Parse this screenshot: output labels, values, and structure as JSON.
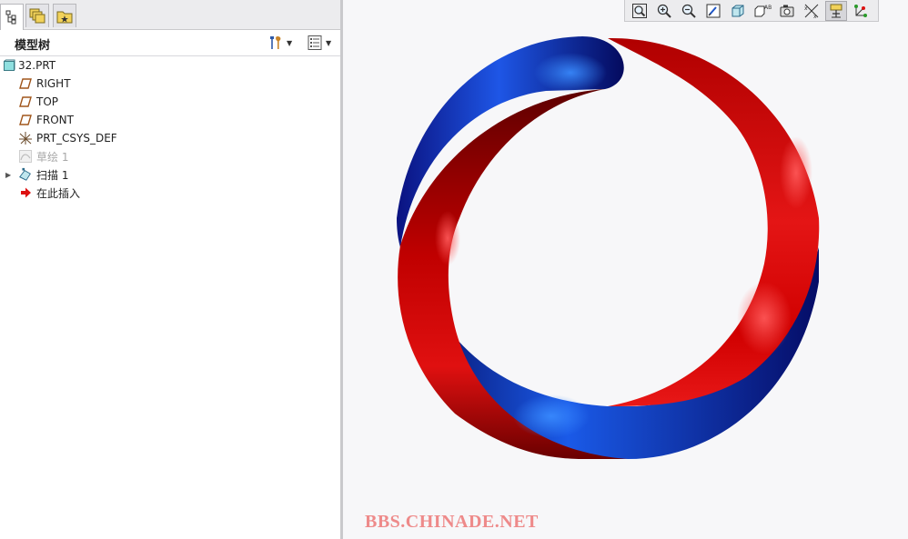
{
  "tabs": [
    {
      "icon": "model-tree-icon"
    },
    {
      "icon": "layers-icon"
    },
    {
      "icon": "folder-favorites-icon"
    }
  ],
  "tree_header": {
    "title": "模型树",
    "settings_icon": "tools-icon",
    "show_icon": "list-settings-icon"
  },
  "tree": {
    "items": [
      {
        "label": "32.PRT",
        "icon": "part-icon",
        "muted": false,
        "expander": false
      },
      {
        "label": "RIGHT",
        "icon": "datum-plane-icon",
        "muted": false,
        "expander": false
      },
      {
        "label": "TOP",
        "icon": "datum-plane-icon",
        "muted": false,
        "expander": false
      },
      {
        "label": "FRONT",
        "icon": "datum-plane-icon",
        "muted": false,
        "expander": false
      },
      {
        "label": "PRT_CSYS_DEF",
        "icon": "csys-icon",
        "muted": false,
        "expander": false
      },
      {
        "label": "草绘 1",
        "icon": "sketch-icon",
        "muted": true,
        "expander": false
      },
      {
        "label": "扫描 1",
        "icon": "sweep-icon",
        "muted": false,
        "expander": true
      },
      {
        "label": "在此插入",
        "icon": "insert-here-arrow-icon",
        "muted": false,
        "expander": false
      }
    ]
  },
  "view_toolbar": [
    {
      "name": "refit-icon"
    },
    {
      "name": "zoom-in-icon"
    },
    {
      "name": "zoom-out-icon"
    },
    {
      "name": "repaint-icon"
    },
    {
      "name": "display-style-icon"
    },
    {
      "name": "saved-views-icon"
    },
    {
      "name": "view-manager-icon"
    },
    {
      "name": "datum-display-icon"
    },
    {
      "name": "spin-center-icon",
      "pressed": true
    },
    {
      "name": "annotation-display-icon"
    }
  ],
  "colors": {
    "red_band": "#d80000",
    "blue_band": "#0a1aa8",
    "viewport_bg": "#f7f7f9"
  },
  "watermark": "BBS.CHINADE.NET"
}
